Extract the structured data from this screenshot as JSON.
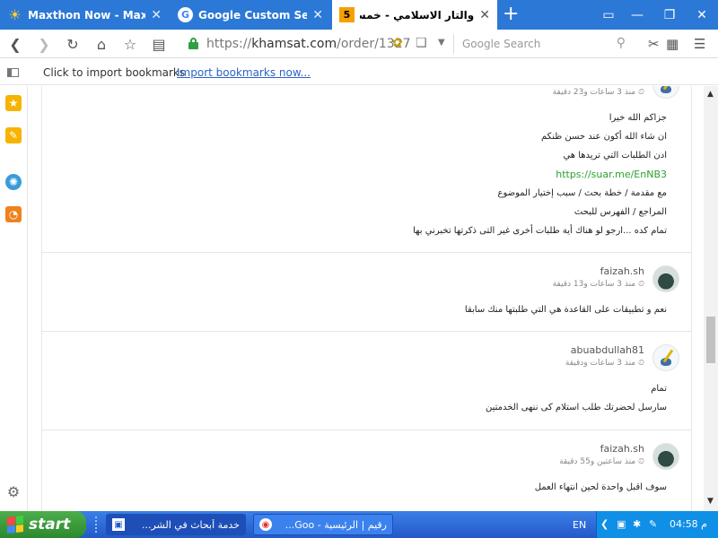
{
  "tabs": [
    {
      "title": "Maxthon Now - Maxth...",
      "icon": "sun-icon"
    },
    {
      "title": "Google Custom Search",
      "icon": "google-icon"
    },
    {
      "title": "والتار الاسلامي - خمسات...",
      "icon": "khamsat-icon",
      "active": true
    }
  ],
  "address": {
    "scheme": "https://",
    "host": "khamsat.com",
    "path": "/order/1327",
    "search_placeholder": "Google Search"
  },
  "bookmarks": {
    "prompt": "Click to import bookmarks",
    "link": "Import bookmarks now..."
  },
  "comments": [
    {
      "name": "",
      "time": "منذ 3 ساعات و23 دقيقة",
      "avatar": "pen",
      "lines": [
        "جزاكم الله خيرا",
        "ان شاء الله أكون عند حسن ظنكم",
        "ادن الطلبات التي تريدها هي",
        "https://suar.me/EnNB3",
        "مع مقدمة / خطة بحث / سبب إختيار الموضوع",
        "المراجع / الفهرس للبحث",
        "تمام كده ...ارجو لو هناك أية طلبات أخرى غير التى ذكرتها تخبرني بها"
      ]
    },
    {
      "name": "faizah.sh",
      "time": "منذ 3 ساعات و13 دقيقة",
      "avatar": "dark",
      "lines": [
        "نعم و تطبيقات على القاعدة هي التي طلبتها منك سابقا"
      ]
    },
    {
      "name": "abuabdullah81",
      "time": "منذ 3 ساعات ودقيقة",
      "avatar": "pen",
      "lines": [
        "تمام",
        "سارسل لحضرتك طلب استلام كى ننهى الخدمتين"
      ]
    },
    {
      "name": "faizah.sh",
      "time": "منذ ساعتين و55 دقيقة",
      "avatar": "dark",
      "lines": [
        "سوف اقبل واحدة لحين انتهاء العمل"
      ]
    }
  ],
  "taskbar": {
    "start": "start",
    "items": [
      {
        "label": "خدمة أبحاث في الشر...",
        "icon": "maxthon-icon"
      },
      {
        "label": "رقيم | الرئيسية - Goo...",
        "icon": "chrome-icon"
      }
    ],
    "lang": "EN",
    "clock": "م 04:58"
  }
}
